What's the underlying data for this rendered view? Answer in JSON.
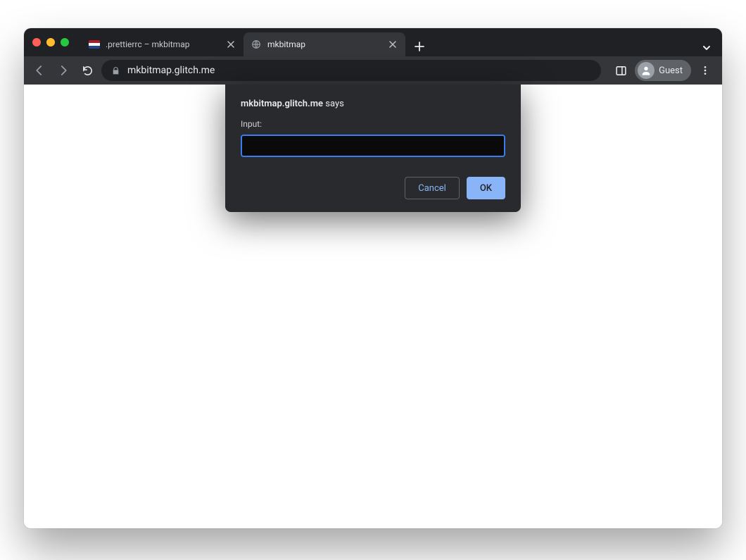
{
  "tabs": [
    {
      "title": ".prettierrc – mkbitmap",
      "active": false
    },
    {
      "title": "mkbitmap",
      "active": true
    }
  ],
  "address_bar": {
    "url_display": "mkbitmap.glitch.me"
  },
  "profile": {
    "label": "Guest"
  },
  "prompt": {
    "host": "mkbitmap.glitch.me",
    "says_suffix": " says",
    "label": "Input:",
    "value": "",
    "cancel_label": "Cancel",
    "ok_label": "OK"
  }
}
